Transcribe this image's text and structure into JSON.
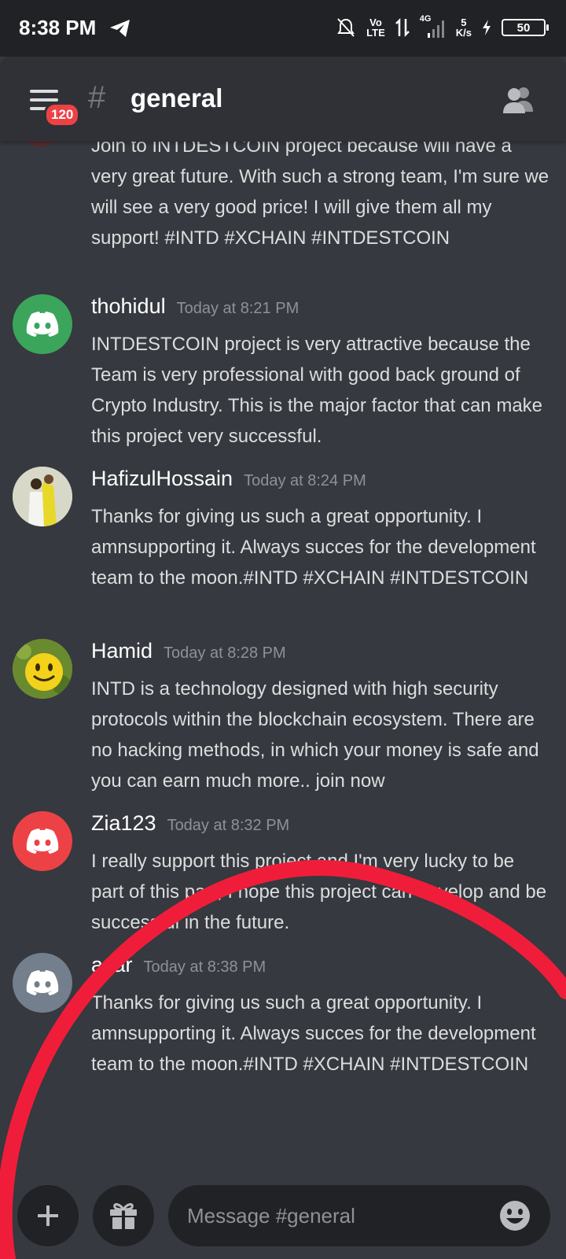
{
  "status_bar": {
    "time": "8:38 PM",
    "network_vo": "Vo",
    "network_lte": "LTE",
    "network_4g": "4G",
    "speed_value": "5",
    "speed_unit": "K/s",
    "battery": "50"
  },
  "header": {
    "unread_badge": "120",
    "hash": "#",
    "channel_name": "general"
  },
  "top_message": {
    "text": "Join to INTDESTCOIN project because will have a very great future. With such a strong team, I'm sure we will see a very good price! I will give them all my support! #INTD #XCHAIN  #INTDESTCOIN"
  },
  "messages": [
    {
      "username": "thohidul",
      "timestamp": "Today at 8:21 PM",
      "text": "INTDESTCOIN project is very attractive because the Team is very professional with good back ground of Crypto Industry. This is the major factor that can make this project very successful.",
      "avatar_color": "#3ba55c"
    },
    {
      "username": "HafizulHossain",
      "timestamp": "Today at 8:24 PM",
      "text": "Thanks for giving us such a great opportunity. I amnsupporting it. Always succes for the development team to the moon.#INTD #XCHAIN #INTDESTCOIN",
      "avatar_color": "#c8c8b0"
    },
    {
      "username": "Hamid",
      "timestamp": "Today at 8:28 PM",
      "text": "INTD is a technology designed with high security protocols within the blockchain ecosystem. There are no hacking methods, in which your money is safe and you can earn much more.. join now",
      "avatar_color": "#7a9a3a"
    },
    {
      "username": "Zia123",
      "timestamp": "Today at 8:32 PM",
      "text": "I really support this project and I'm very lucky to be part of this part, I hope this project can develop and be successful in the future.",
      "avatar_color": "#ed4245"
    },
    {
      "username": "azar",
      "timestamp": "Today at 8:38 PM",
      "text": "Thanks for giving us such a great opportunity. I amnsupporting it. Always succes for the development team to the moon.#INTD #XCHAIN #INTDESTCOIN",
      "avatar_color": "#747f8d"
    }
  ],
  "input": {
    "placeholder": "Message #general"
  },
  "colors": {
    "background": "#36393f",
    "header": "#2f3136",
    "annotation": "#f01d3a",
    "badge": "#ed4245"
  }
}
